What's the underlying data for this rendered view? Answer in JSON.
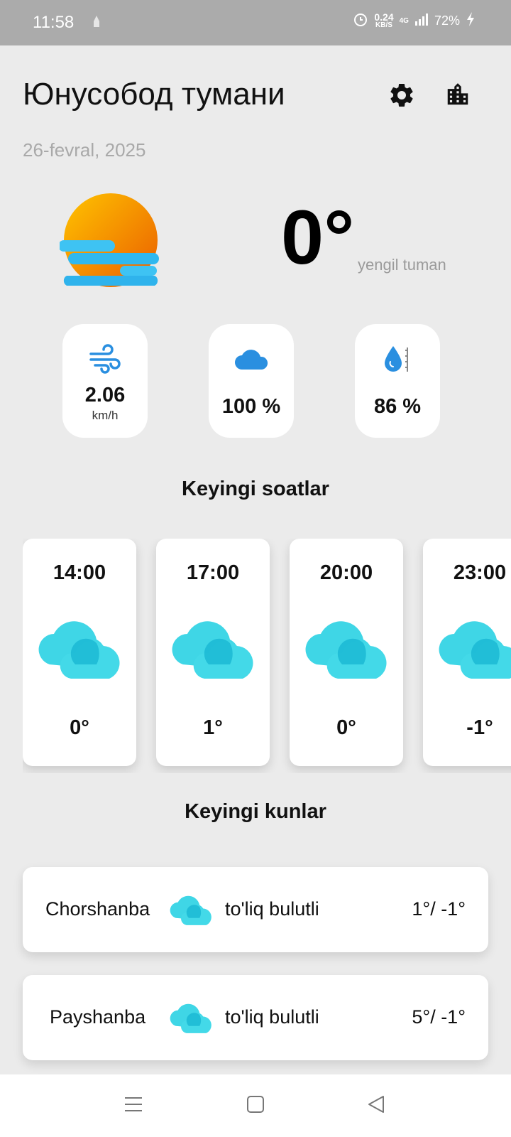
{
  "status_bar": {
    "time": "11:58",
    "speed_value": "0.24",
    "speed_unit": "KB/S",
    "network": "4G",
    "battery": "72%",
    "icons": [
      "notification-icon",
      "alarm-icon",
      "signal-icon",
      "battery-charging-icon"
    ]
  },
  "header": {
    "location": "Юнусобод тумани",
    "date": "26-fevral, 2025",
    "icons": [
      "gear-icon",
      "city-icon"
    ]
  },
  "current": {
    "temperature": "0°",
    "condition": "yengil tuman",
    "icon": "sun-fog-icon"
  },
  "stats": [
    {
      "icon": "wind-icon",
      "value": "2.06",
      "unit": "km/h"
    },
    {
      "icon": "cloud-icon",
      "value": "100 %"
    },
    {
      "icon": "humidity-icon",
      "value": "86 %"
    }
  ],
  "hourly": {
    "title": "Keyingi soatlar",
    "items": [
      {
        "time": "14:00",
        "temp": "0°",
        "icon": "cloud-icon"
      },
      {
        "time": "17:00",
        "temp": "1°",
        "icon": "cloud-icon"
      },
      {
        "time": "20:00",
        "temp": "0°",
        "icon": "cloud-icon"
      },
      {
        "time": "23:00",
        "temp": "-1°",
        "icon": "cloud-icon"
      }
    ]
  },
  "daily": {
    "title": "Keyingi kunlar",
    "items": [
      {
        "day": "Chorshanba",
        "desc": "to'liq bulutli",
        "range": "1°/ -1°",
        "icon": "cloud-icon"
      },
      {
        "day": "Payshanba",
        "desc": "to'liq bulutli",
        "range": "5°/ -1°",
        "icon": "cloud-icon"
      }
    ]
  },
  "nav": [
    "menu-icon",
    "home-icon",
    "back-icon"
  ],
  "colors": {
    "background": "#ebebeb",
    "status_bar": "#ababab",
    "cloud": "#3fd6e6",
    "cloud_dark": "#1bb8d3",
    "accent_blue": "#2a8fe0",
    "sun_top": "#ffb400",
    "sun_bottom": "#ee6a00"
  }
}
